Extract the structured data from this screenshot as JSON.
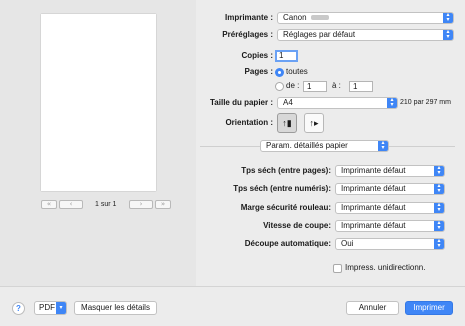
{
  "preview": {
    "page_count": "1 sur 1",
    "first_icon": "«",
    "prev_icon": "‹",
    "next_icon": "›",
    "last_icon": "»"
  },
  "printer": {
    "label": "Imprimante :",
    "value": "Canon"
  },
  "presets": {
    "label": "Préréglages :",
    "value": "Réglages par défaut"
  },
  "copies": {
    "label": "Copies :",
    "value": "1"
  },
  "pages": {
    "label": "Pages :",
    "all_label": "toutes",
    "from_label": "de :",
    "from_value": "1",
    "to_label": "à :",
    "to_value": "1"
  },
  "paper_size": {
    "label": "Taille du papier :",
    "value": "A4",
    "dimensions": "210 par 297 mm"
  },
  "orientation": {
    "label": "Orientation :",
    "portrait_icon": "portrait-icon",
    "landscape_icon": "landscape-icon"
  },
  "panel": {
    "value": "Param. détaillés papier"
  },
  "settings": [
    {
      "label": "Tps séch (entre pages):",
      "value": "Imprimante défaut"
    },
    {
      "label": "Tps séch (entre numéris):",
      "value": "Imprimante défaut"
    },
    {
      "label": "Marge sécurité rouleau:",
      "value": "Imprimante défaut"
    },
    {
      "label": "Vitesse de coupe:",
      "value": "Imprimante défaut"
    },
    {
      "label": "Découpe automatique:",
      "value": "Oui"
    }
  ],
  "unidirectional": {
    "label": "Impress. unidirectionn."
  },
  "footer": {
    "help": "?",
    "pdf": "PDF",
    "hide_details": "Masquer les détails",
    "cancel": "Annuler",
    "print": "Imprimer"
  }
}
